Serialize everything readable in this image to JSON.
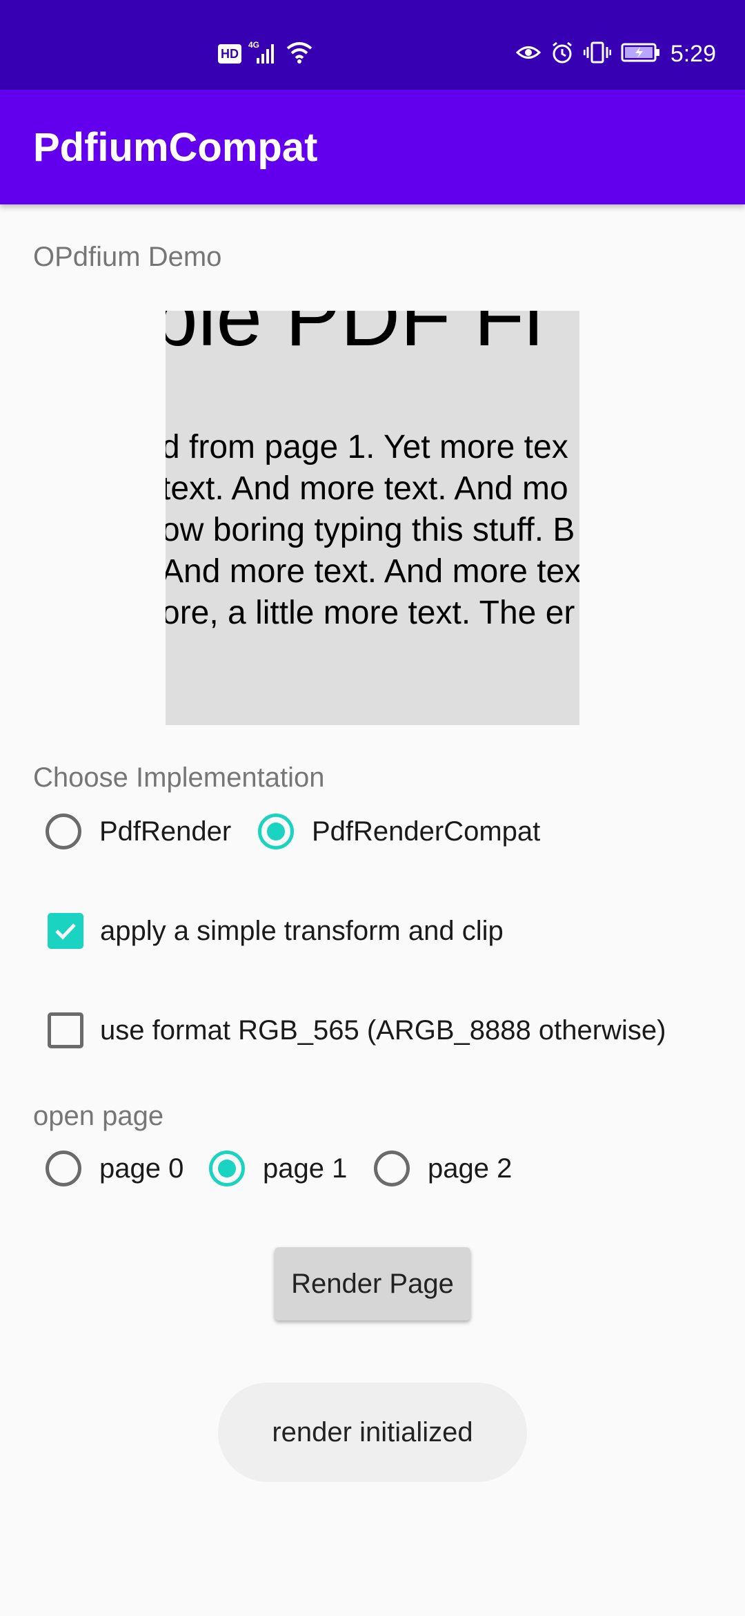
{
  "status_bar": {
    "hd_badge": "HD",
    "network_label": "4G",
    "time": "5:29",
    "icons": [
      "hd-icon",
      "signal-icon",
      "wifi-icon",
      "eye-icon",
      "alarm-icon",
      "vibrate-icon",
      "battery-charging-icon"
    ]
  },
  "app_bar": {
    "title": "PdfiumCompat"
  },
  "demo": {
    "label": "OPdfium Demo"
  },
  "pdf_preview": {
    "heading": "ble PDF Fi",
    "lines": [
      "d from page 1. Yet more tex",
      "text. And more text. And mo",
      "ow boring typing this stuff. B",
      "And more text. And more tex",
      "ore, a little more text. The er"
    ]
  },
  "implementation": {
    "label": "Choose Implementation",
    "options": [
      {
        "label": "PdfRender",
        "selected": false
      },
      {
        "label": "PdfRenderCompat",
        "selected": true
      }
    ]
  },
  "options": {
    "transform_label": "apply a simple transform and clip",
    "transform_checked": true,
    "rgb_label": "use format RGB_565 (ARGB_8888 otherwise)",
    "rgb_checked": false
  },
  "open_page": {
    "label": "open page",
    "pages": [
      {
        "label": "page 0",
        "selected": false
      },
      {
        "label": "page 1",
        "selected": true
      },
      {
        "label": "page 2",
        "selected": false
      }
    ]
  },
  "render_button": {
    "label": "Render Page"
  },
  "toast": {
    "message": "render initialized"
  },
  "colors": {
    "status_bar": "#3700b3",
    "app_bar": "#6200ee",
    "accent": "#1ad3c0"
  }
}
